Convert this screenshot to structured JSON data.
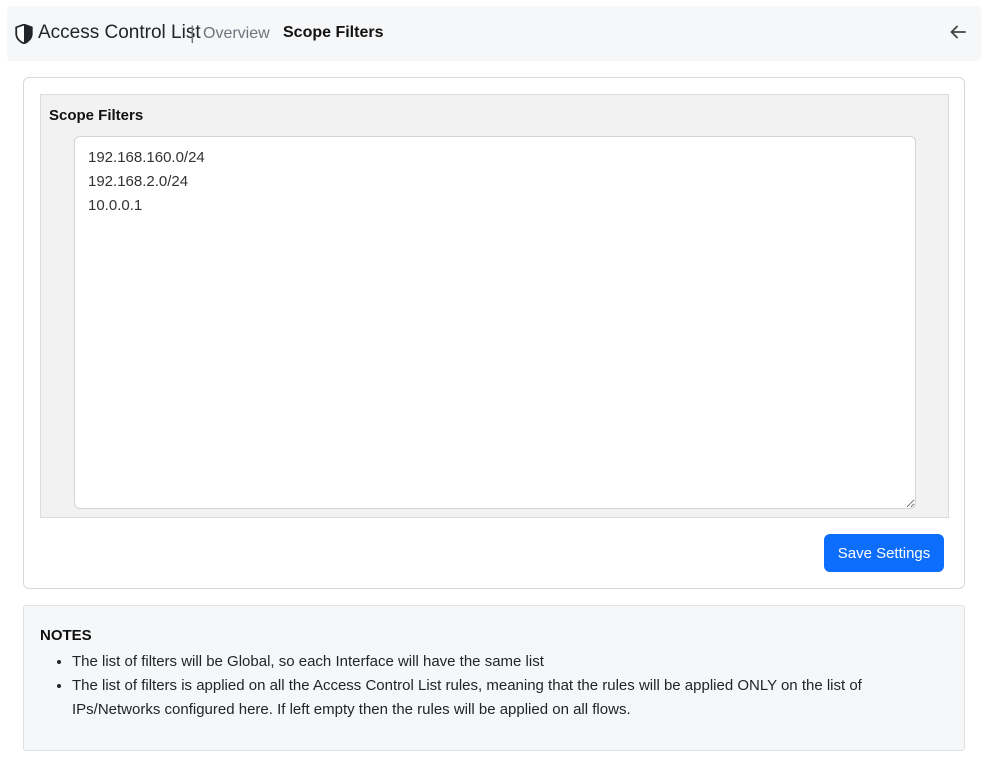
{
  "header": {
    "icon": "shield-icon",
    "app_title": "Access Control List",
    "separator": "|",
    "breadcrumb_overview": "Overview",
    "breadcrumb_active": "Scope Filters",
    "back_icon": "arrow-left-icon"
  },
  "form": {
    "label": "Scope Filters",
    "filters_value": "192.168.160.0/24\n192.168.2.0/24\n10.0.0.1",
    "save_label": "Save Settings"
  },
  "notes": {
    "title": "NOTES",
    "items": [
      "The list of filters will be Global, so each Interface will have the same list",
      "The list of filters is applied on all the Access Control List rules, meaning that the rules will be applied ONLY on the list of IPs/Networks configured here. If left empty then the rules will be applied on all flows."
    ]
  },
  "colors": {
    "primary": "#0d6efd",
    "topbar_bg": "#f6f7f9",
    "form_bg": "#f2f2f2"
  }
}
